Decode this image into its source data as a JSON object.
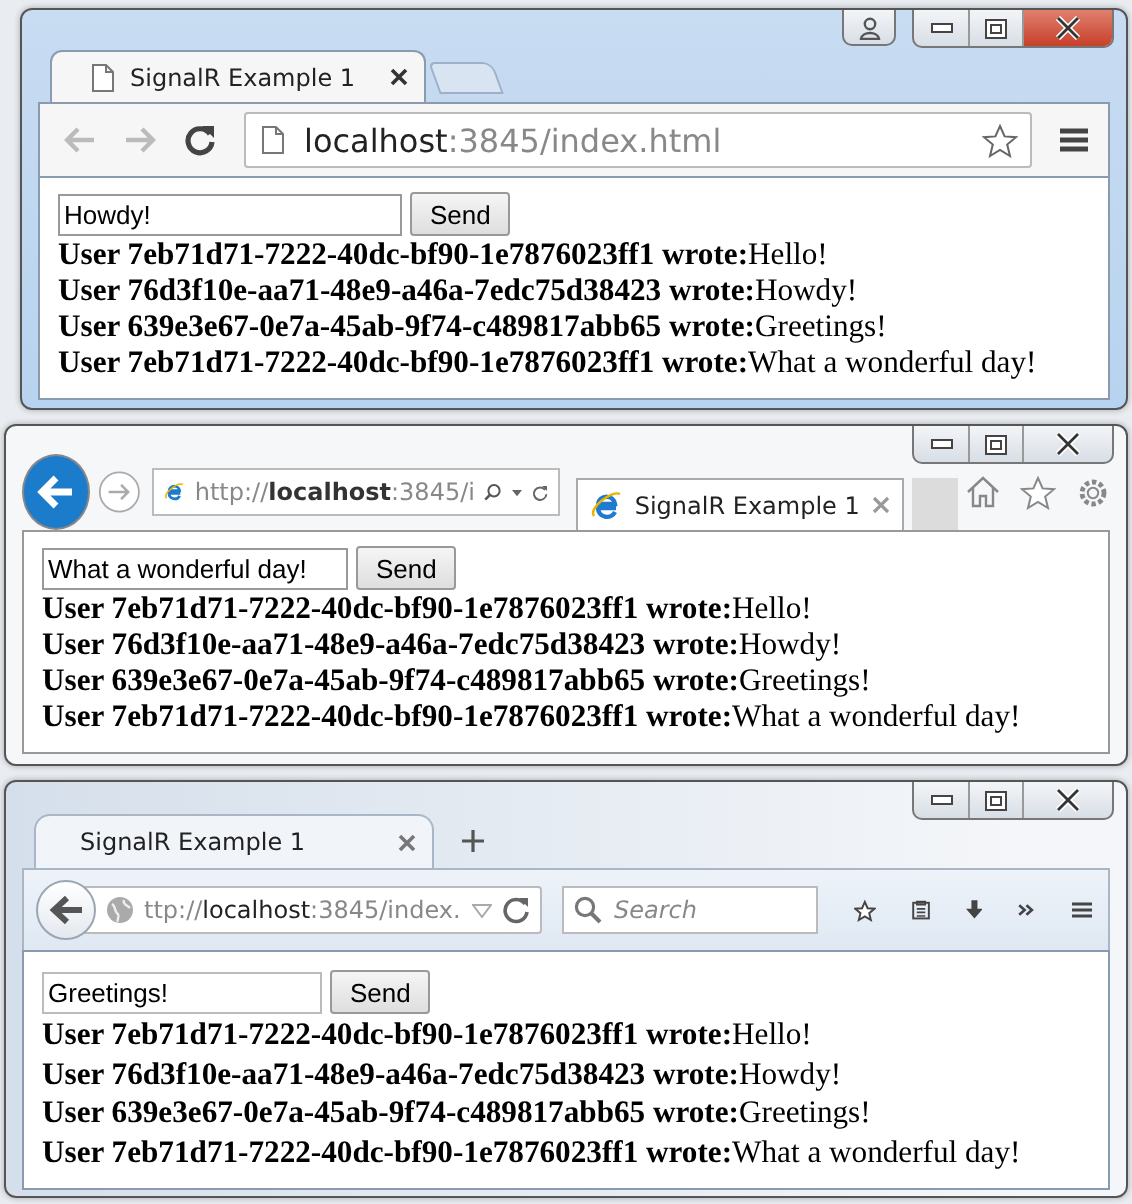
{
  "windows": [
    {
      "kind": "chrome",
      "tab_title": "SignalR Example 1",
      "address": {
        "host": "localhost",
        "suffix": ":3845/index.html"
      },
      "input_value": "Howdy!",
      "button_label": "Send",
      "messages": [
        "**User 7eb71d71-7222-40dc-bf90-1e7876023ff1 wrote:**Hello!",
        "**User 76d3f10e-aa71-48e9-a46a-7edc75d38423 wrote:**Howdy!",
        "**User 639e3e67-0e7a-45ab-9f74-c489817abb65 wrote:**Greetings!",
        "**User 7eb71d71-7222-40dc-bf90-1e7876023ff1 wrote:**What a wonderful day!"
      ]
    },
    {
      "kind": "ie",
      "tab_title": "SignalR Example 1",
      "address": {
        "prefix": "http://",
        "host": "localhost",
        "suffix": ":3845/i"
      },
      "input_value": "What a wonderful day!",
      "button_label": "Send",
      "messages": [
        "**User 7eb71d71-7222-40dc-bf90-1e7876023ff1 wrote:**Hello!",
        "**User 76d3f10e-aa71-48e9-a46a-7edc75d38423 wrote:**Howdy!",
        "**User 639e3e67-0e7a-45ab-9f74-c489817abb65 wrote:**Greetings!",
        "**User 7eb71d71-7222-40dc-bf90-1e7876023ff1 wrote:**What a wonderful day!"
      ]
    },
    {
      "kind": "firefox",
      "tab_title": "SignalR Example 1",
      "address": {
        "prefix": "ttp://",
        "host": "localhost",
        "suffix": ":3845/index."
      },
      "search": {
        "placeholder": "Search"
      },
      "input_value": "Greetings!",
      "button_label": "Send",
      "messages": [
        "**User 7eb71d71-7222-40dc-bf90-1e7876023ff1 wrote:**Hello!",
        "**User 76d3f10e-aa71-48e9-a46a-7edc75d38423 wrote:**Howdy!",
        "**User 639e3e67-0e7a-45ab-9f74-c489817abb65 wrote:**Greetings!",
        "**User 7eb71d71-7222-40dc-bf90-1e7876023ff1 wrote:**What a wonderful day!"
      ]
    }
  ]
}
